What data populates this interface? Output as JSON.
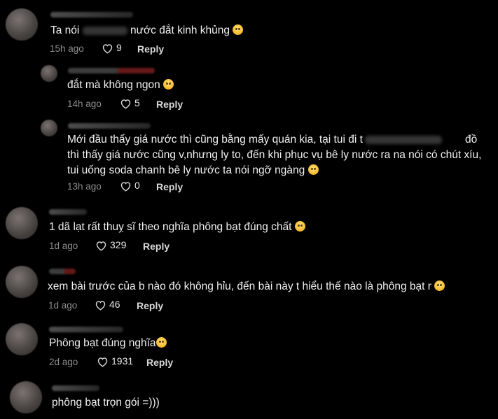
{
  "icons": {
    "like": "heart-outline-icon",
    "emoji": "laughing-face-icon"
  },
  "comments": [
    {
      "text_pre": "Ta nói",
      "text_post": "nước đắt kinh khủng",
      "time": "15h ago",
      "likes": "9",
      "reply": "Reply"
    },
    {
      "text": "đắt mà không ngon",
      "time": "14h ago",
      "likes": "5",
      "reply": "Reply"
    },
    {
      "text_line1_pre": "Mới đầu thấy giá nước thì cũng bằng mấy quán kia, tại tui đi t",
      "text_line1_post": "đồ",
      "text_rest": "thì thấy giá nước cũng v,nhưng ly to, đến khi phục vụ bê ly nước ra na nói có chút xíu, tui uống soda chanh bê ly nước ta nói ngỡ ngàng",
      "time": "13h ago",
      "likes": "0",
      "reply": "Reply"
    },
    {
      "text": "1 dã lạt rất thuỵ sĩ theo nghĩa phông bạt đúng chất",
      "time": "1d ago",
      "likes": "329",
      "reply": "Reply"
    },
    {
      "text": "xem bài trước của b nào đó không hỉu, đến bài này t hiểu thế nào là phông bạt r",
      "time": "1d ago",
      "likes": "46",
      "reply": "Reply"
    },
    {
      "text": "Phông bạt đúng nghĩa",
      "time": "2d ago",
      "likes": "1931",
      "reply": "Reply"
    },
    {
      "text": "phông bạt trọn gói =)))",
      "time": "",
      "likes": "",
      "reply": ""
    }
  ]
}
